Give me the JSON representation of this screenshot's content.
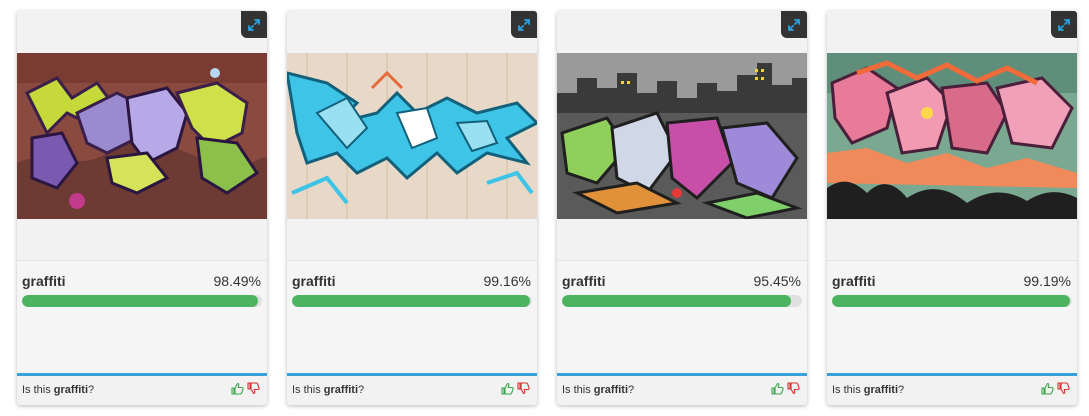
{
  "colors": {
    "progress_fill": "#4cb461",
    "progress_track": "#e0e0e0",
    "feedback_border": "#3aa0dc",
    "thumb_up": "#3aa54c",
    "thumb_down": "#d6312f",
    "expand_button_bg": "#333333",
    "expand_icon": "#29a3e0"
  },
  "cards": [
    {
      "image_icon": "graffiti-image-purple-yellow",
      "label": "graffiti",
      "score_text": "98.49%",
      "score": 0.9849,
      "question_prefix": "Is this ",
      "question_label": "graffiti",
      "question_suffix": "?"
    },
    {
      "image_icon": "graffiti-image-blue",
      "label": "graffiti",
      "score_text": "99.16%",
      "score": 0.9916,
      "question_prefix": "Is this ",
      "question_label": "graffiti",
      "question_suffix": "?"
    },
    {
      "image_icon": "graffiti-image-skyline",
      "label": "graffiti",
      "score_text": "95.45%",
      "score": 0.9545,
      "question_prefix": "Is this ",
      "question_label": "graffiti",
      "question_suffix": "?"
    },
    {
      "image_icon": "graffiti-image-pink-orange",
      "label": "graffiti",
      "score_text": "99.19%",
      "score": 0.9919,
      "question_prefix": "Is this ",
      "question_label": "graffiti",
      "question_suffix": "?"
    }
  ]
}
